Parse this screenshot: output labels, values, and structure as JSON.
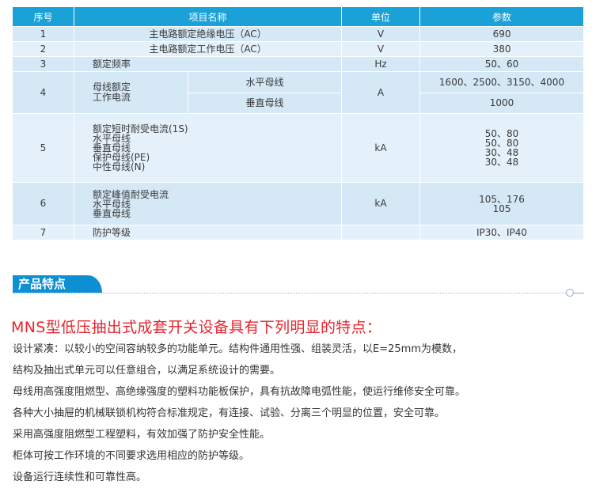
{
  "table": {
    "headers": [
      "序号",
      "项目名称",
      "单位",
      "参数"
    ],
    "rows": [
      {
        "no": "1",
        "item": "主电路额定绝缘电压（AC）",
        "unit": "V",
        "value": "690"
      },
      {
        "no": "2",
        "item": "主电路额定工作电压（AC）",
        "unit": "V",
        "value": "380"
      },
      {
        "no": "3",
        "item": "额定频率",
        "unit": "Hz",
        "value": "50、60"
      },
      {
        "no": "4",
        "item_lines": [
          "母线额定",
          "工作电流"
        ],
        "sub1": "水平母线",
        "sub2": "垂直母线",
        "unit": "A",
        "value1": "1600、2500、3150、4000",
        "value2": "1000"
      },
      {
        "no": "5",
        "item_lines": [
          "额定短时耐受电流(1S)",
          "水平母线",
          "垂直母线",
          "保护母线(PE)",
          "中性母线(N)"
        ],
        "unit": "kA",
        "value_lines": [
          "50、80",
          "50、80",
          "30、48",
          "30、48"
        ]
      },
      {
        "no": "6",
        "item_lines": [
          "额定峰值耐受电流",
          "水平母线",
          "垂直母线"
        ],
        "unit": "kA",
        "value_lines": [
          "105、176",
          "105"
        ]
      },
      {
        "no": "7",
        "item": "防护等级",
        "unit": "",
        "value": "IP30、IP40"
      }
    ]
  },
  "section": {
    "title": "产品特点"
  },
  "headline": "MNS型低压抽出式成套开关设备具有下列明显的特点：",
  "features": [
    "设计紧凑：以较小的空间容纳较多的功能单元。结构件通用性强、组装灵活，以E=25mm为模数，",
    "结构及抽出式单元可以任意组合，以满足系统设计的需要。",
    "母线用高强度阻燃型、高绝缘强度的塑料功能板保护，具有抗故障电弧性能，使运行维修安全可靠。",
    "各种大小抽屉的机械联锁机构符合标准规定，有连接、试验、分离三个明显的位置，安全可靠。",
    "采用高强度阻燃型工程塑料，有效加强了防护安全性能。",
    "柜体可按工作环境的不同要求选用相应的防护等级。",
    "设备运行连续性和可靠性高。"
  ],
  "colors": {
    "header_bg": "#1aa2d8",
    "row_bg": "#d5e8f6",
    "row_alt_bg": "#e4f1fa",
    "section_tab": "#0e8fd4",
    "headline": "#e5262f"
  }
}
